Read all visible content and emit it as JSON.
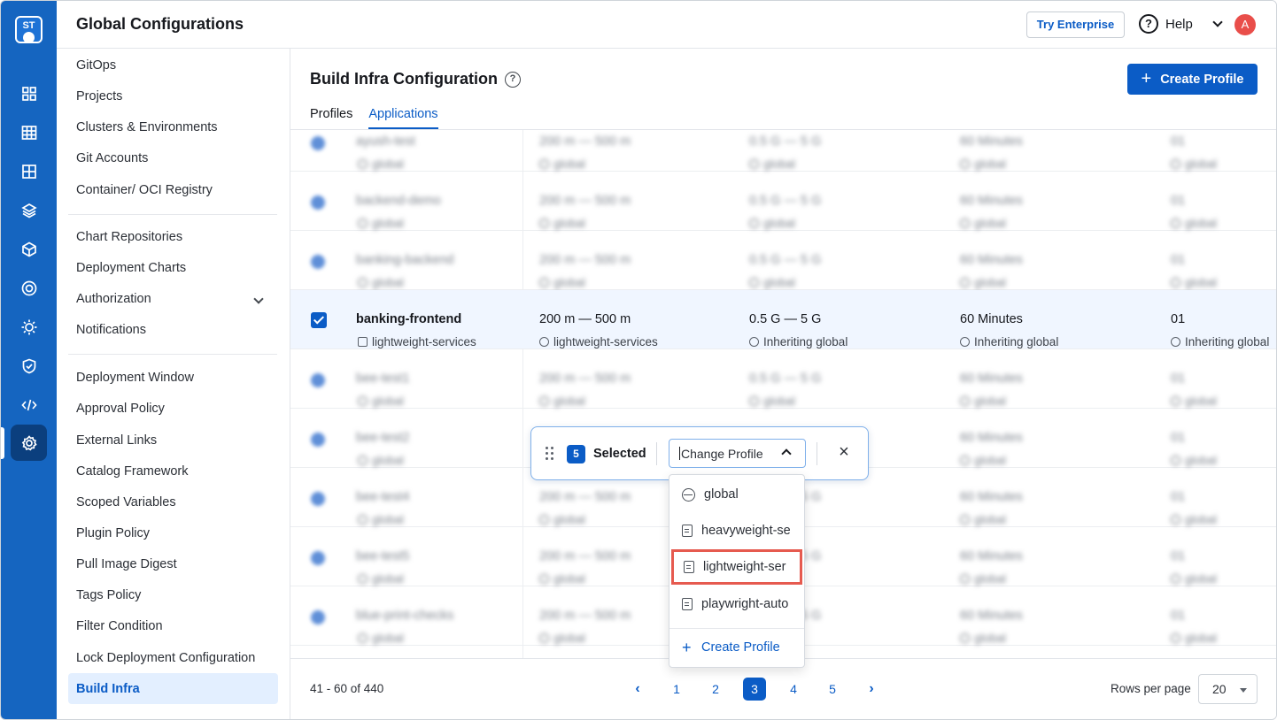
{
  "app": {
    "logo_text": "ST",
    "header_title": "Global Configurations",
    "try_enterprise": "Try Enterprise",
    "help_label": "Help",
    "avatar_initial": "A",
    "brand_color": "#1565c0",
    "accent_color": "#0b5cc6"
  },
  "rail": {
    "icons": [
      "apps-grid-icon",
      "dashboard-grid-icon",
      "window-grid-icon",
      "stack-icon",
      "cube-icon",
      "target-icon",
      "sun-gear-icon",
      "shield-check-icon",
      "code-icon",
      "settings-gear-icon"
    ],
    "active": "settings-gear-icon"
  },
  "subnav": {
    "items": [
      "GitOps",
      "Projects",
      "Clusters & Environments",
      "Git Accounts",
      "Container/ OCI Registry",
      "Chart Repositories",
      "Deployment Charts",
      "Authorization",
      "Notifications",
      "Deployment Window",
      "Approval Policy",
      "External Links",
      "Catalog Framework",
      "Scoped Variables",
      "Plugin Policy",
      "Pull Image Digest",
      "Tags Policy",
      "Filter Condition",
      "Lock Deployment Configuration",
      "Build Infra"
    ],
    "active": "Build Infra"
  },
  "main": {
    "title": "Build Infra Configuration",
    "help_icon": "question-circle-icon",
    "create_button": "Create Profile",
    "tabs": [
      "Profiles",
      "Applications"
    ],
    "active_tab": "Applications"
  },
  "table": {
    "rows": [
      {
        "name": "ayush-test",
        "profile": "global",
        "cpu": "200 m — 500 m",
        "cpu_sub": "global",
        "mem": "0.5 G — 5 G",
        "mem_sub": "global",
        "timeout": "60 Minutes",
        "timeout_sub": "global",
        "node": "01",
        "node_sub": "global",
        "blurred": true,
        "checked": false
      },
      {
        "name": "backend-demo",
        "profile": "global",
        "cpu": "200 m — 500 m",
        "cpu_sub": "global",
        "mem": "0.5 G — 5 G",
        "mem_sub": "global",
        "timeout": "60 Minutes",
        "timeout_sub": "global",
        "node": "01",
        "node_sub": "global",
        "blurred": true,
        "checked": false
      },
      {
        "name": "banking-backend",
        "profile": "global",
        "cpu": "200 m — 500 m",
        "cpu_sub": "global",
        "mem": "0.5 G — 5 G",
        "mem_sub": "global",
        "timeout": "60 Minutes",
        "timeout_sub": "global",
        "node": "01",
        "node_sub": "global",
        "blurred": true,
        "checked": false
      },
      {
        "name": "banking-frontend",
        "profile": "lightweight-services",
        "cpu": "200 m — 500 m",
        "cpu_sub": "lightweight-services",
        "mem": "0.5 G — 5 G",
        "mem_sub": "Inheriting global",
        "timeout": "60 Minutes",
        "timeout_sub": "Inheriting global",
        "node": "01",
        "node_sub": "Inheriting global",
        "blurred": false,
        "checked": true
      },
      {
        "name": "bee-test1",
        "profile": "global",
        "cpu": "200 m — 500 m",
        "cpu_sub": "global",
        "mem": "0.5 G — 5 G",
        "mem_sub": "global",
        "timeout": "60 Minutes",
        "timeout_sub": "global",
        "node": "01",
        "node_sub": "global",
        "blurred": true,
        "checked": false
      },
      {
        "name": "bee-test2",
        "profile": "global",
        "cpu": "200 m — 500 m",
        "cpu_sub": "global",
        "mem": "0.5 G — 5 G",
        "mem_sub": "global",
        "timeout": "60 Minutes",
        "timeout_sub": "global",
        "node": "01",
        "node_sub": "global",
        "blurred": true,
        "checked": false
      },
      {
        "name": "bee-test4",
        "profile": "global",
        "cpu": "200 m — 500 m",
        "cpu_sub": "global",
        "mem": "0.5 G — 5 G",
        "mem_sub": "global",
        "timeout": "60 Minutes",
        "timeout_sub": "global",
        "node": "01",
        "node_sub": "global",
        "blurred": true,
        "checked": false
      },
      {
        "name": "bee-test5",
        "profile": "global",
        "cpu": "200 m — 500 m",
        "cpu_sub": "global",
        "mem": "0.5 G — 5 G",
        "mem_sub": "global",
        "timeout": "60 Minutes",
        "timeout_sub": "global",
        "node": "01",
        "node_sub": "global",
        "blurred": true,
        "checked": false
      },
      {
        "name": "blue-print-checks",
        "profile": "global",
        "cpu": "200 m — 500 m",
        "cpu_sub": "global",
        "mem": "0.5 G — 5 G",
        "mem_sub": "global",
        "timeout": "60 Minutes",
        "timeout_sub": "global",
        "node": "01",
        "node_sub": "global",
        "blurred": true,
        "checked": false
      }
    ]
  },
  "pagination": {
    "range": "41 - 60 of 440",
    "pages": [
      "1",
      "2",
      "3",
      "4",
      "5"
    ],
    "current": "3",
    "rows_per_page_label": "Rows per page",
    "rows_per_page": "20"
  },
  "selection_bar": {
    "count": "5",
    "label": "Selected",
    "dropdown_placeholder": "Change Profile",
    "menu": [
      "global",
      "heavyweight-se",
      "lightweight-ser",
      "playwright-auto"
    ],
    "highlighted": "lightweight-ser",
    "create": "Create Profile"
  }
}
